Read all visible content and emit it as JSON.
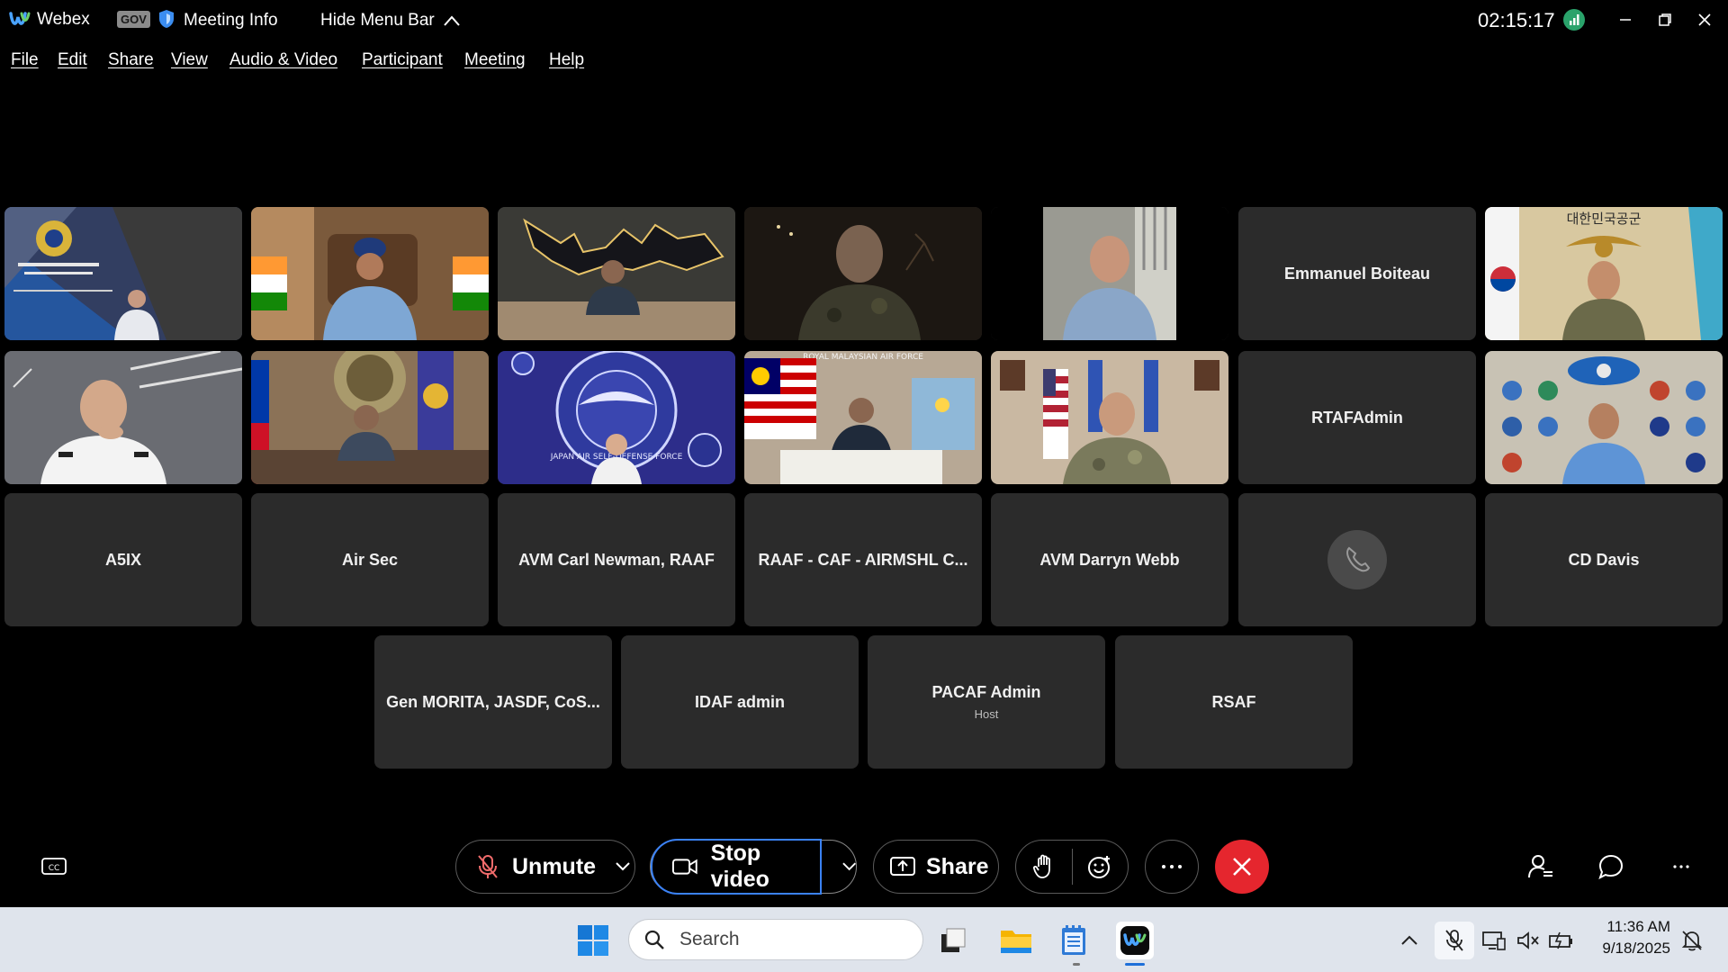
{
  "titlebar": {
    "app_name": "Webex",
    "gov_badge": "GOV",
    "meeting_info": "Meeting Info",
    "hide_menu_bar": "Hide Menu Bar",
    "meeting_timer": "02:15:17"
  },
  "menu": [
    "File",
    "Edit",
    "Share",
    "View",
    "Audio & Video",
    "Participant",
    "Meeting",
    "Help"
  ],
  "participants": {
    "row1": [
      {
        "type": "video",
        "scene": "royal-brunei-air-force"
      },
      {
        "type": "video",
        "scene": "officer-turban-desk"
      },
      {
        "type": "video",
        "scene": "indonesia-map-wall"
      },
      {
        "type": "video",
        "scene": "dark-room-camouflage"
      },
      {
        "type": "video",
        "scene": "officer-blue-shirt"
      },
      {
        "type": "name",
        "name": "Emmanuel Boiteau"
      },
      {
        "type": "video",
        "scene": "republic-of-korea-air-force",
        "banner_text": "대한민국공군"
      }
    ],
    "row2": [
      {
        "type": "video",
        "scene": "officer-white-uniform"
      },
      {
        "type": "video",
        "scene": "philippine-air-force"
      },
      {
        "type": "video",
        "scene": "japan-air-self-defense-force",
        "banner_text": "JAPAN AIR SELF-DEFENSE FORCE"
      },
      {
        "type": "video",
        "scene": "royal-malaysian-air-force",
        "banner_text": "ROYAL MALAYSIAN AIR FORCE"
      },
      {
        "type": "video",
        "scene": "us-general-flags"
      },
      {
        "type": "name",
        "name": "RTAFAdmin"
      },
      {
        "type": "video",
        "scene": "officer-with-insignia-wall"
      }
    ],
    "row3": [
      {
        "type": "name",
        "name": "A5IX"
      },
      {
        "type": "name",
        "name": "Air Sec"
      },
      {
        "type": "name",
        "name": "AVM Carl Newman, RAAF"
      },
      {
        "type": "name",
        "name": "RAAF - CAF - AIRMSHL C..."
      },
      {
        "type": "name",
        "name": "AVM Darryn Webb"
      },
      {
        "type": "phone"
      },
      {
        "type": "name",
        "name": "CD Davis"
      }
    ],
    "row4": [
      {
        "type": "name",
        "name": "Gen MORITA, JASDF, CoS..."
      },
      {
        "type": "name",
        "name": "IDAF admin"
      },
      {
        "type": "name",
        "name": "PACAF Admin",
        "role": "Host"
      },
      {
        "type": "name",
        "name": "RSAF"
      }
    ]
  },
  "controls": {
    "unmute": "Unmute",
    "stop_video": "Stop video",
    "share": "Share",
    "end_color": "#e5262e"
  },
  "taskbar": {
    "search_placeholder": "Search",
    "time": "11:36 AM",
    "date": "9/18/2025"
  }
}
